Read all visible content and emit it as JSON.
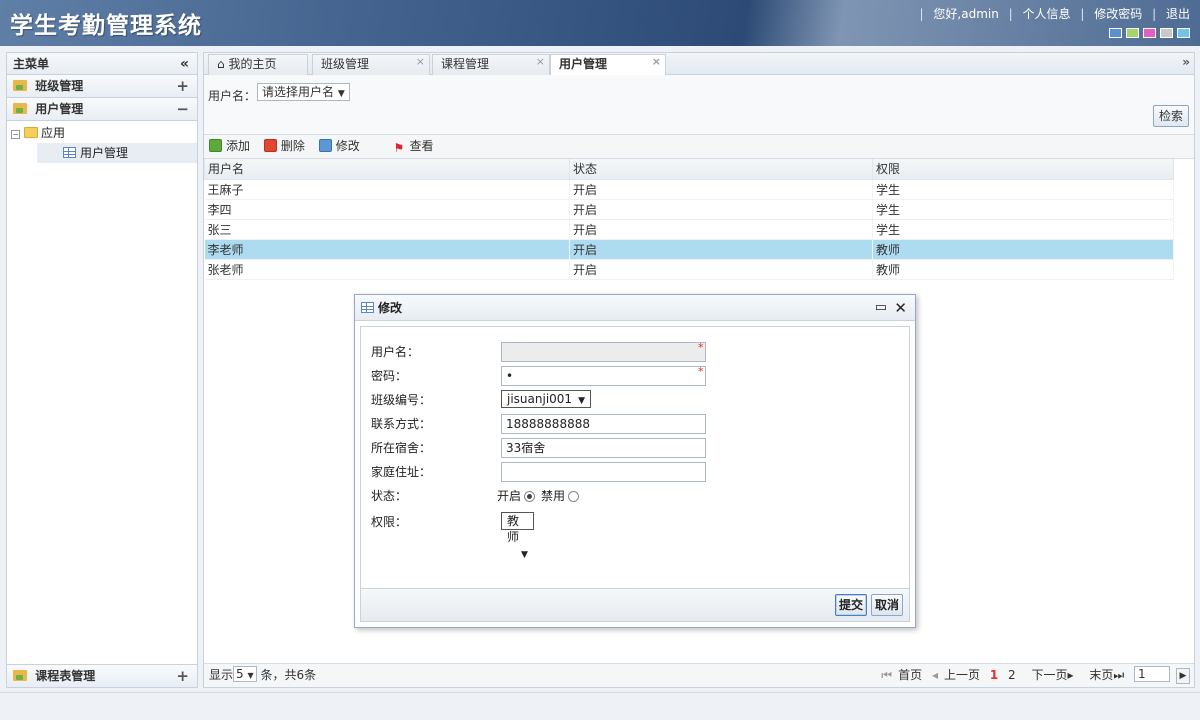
{
  "header": {
    "title": "学生考勤管理系统",
    "greeting": "您好,admin",
    "profile": "个人信息",
    "change_password": "修改密码",
    "logout": "退出",
    "theme_colors": [
      "#5b8fd0",
      "#a5d46a",
      "#e25fc4",
      "#c9c9c9",
      "#6fc6e8"
    ]
  },
  "sidebar": {
    "title": "主菜单",
    "collapse_glyph": "«",
    "groups": [
      {
        "label": "班级管理",
        "toggle": "+"
      },
      {
        "label": "用户管理",
        "toggle": "−"
      }
    ],
    "tree": {
      "folder": "应用",
      "item": "用户管理"
    },
    "bottom_group": {
      "label": "课程表管理",
      "toggle": "+"
    }
  },
  "tabs": [
    {
      "label": "我的主页",
      "icon": "home-icon"
    },
    {
      "label": "班级管理",
      "close": "×"
    },
    {
      "label": "课程管理",
      "close": "×"
    },
    {
      "label": "用户管理",
      "close": "×",
      "active": true
    }
  ],
  "tab_more": "»",
  "search": {
    "label": "用户名：",
    "select_value": "请选择用户名",
    "button": "检索"
  },
  "toolbar": {
    "add": "添加",
    "delete": "删除",
    "edit": "修改",
    "view": "查看"
  },
  "table": {
    "columns": [
      "用户名",
      "状态",
      "权限"
    ],
    "rows": [
      [
        "王麻子",
        "开启",
        "学生"
      ],
      [
        "李四",
        "开启",
        "学生"
      ],
      [
        "张三",
        "开启",
        "学生"
      ],
      [
        "李老师",
        "开启",
        "教师"
      ],
      [
        "张老师",
        "开启",
        "教师"
      ]
    ],
    "selected_row": 3
  },
  "pager": {
    "show": "显示",
    "page_size": "5",
    "summary": "条，共6条",
    "first": "首页",
    "prev": "上一页",
    "page1": "1",
    "page2": "2",
    "next": "下一页",
    "last": "末页",
    "current": "1"
  },
  "dialog": {
    "title": "修改",
    "fields": {
      "username_label": "用户名：",
      "username_value": "",
      "password_label": "密码：",
      "password_value": "•",
      "class_label": "班级编号：",
      "class_value": "jisuanji001",
      "contact_label": "联系方式：",
      "contact_value": "18888888888",
      "dorm_label": "所在宿舍：",
      "dorm_value": "33宿舍",
      "address_label": "家庭住址：",
      "address_value": "",
      "status_label": "状态：",
      "status_on": "开启",
      "status_off": "禁用",
      "role_label": "权限：",
      "role_value": "教师"
    },
    "submit": "提交",
    "cancel": "取消"
  }
}
